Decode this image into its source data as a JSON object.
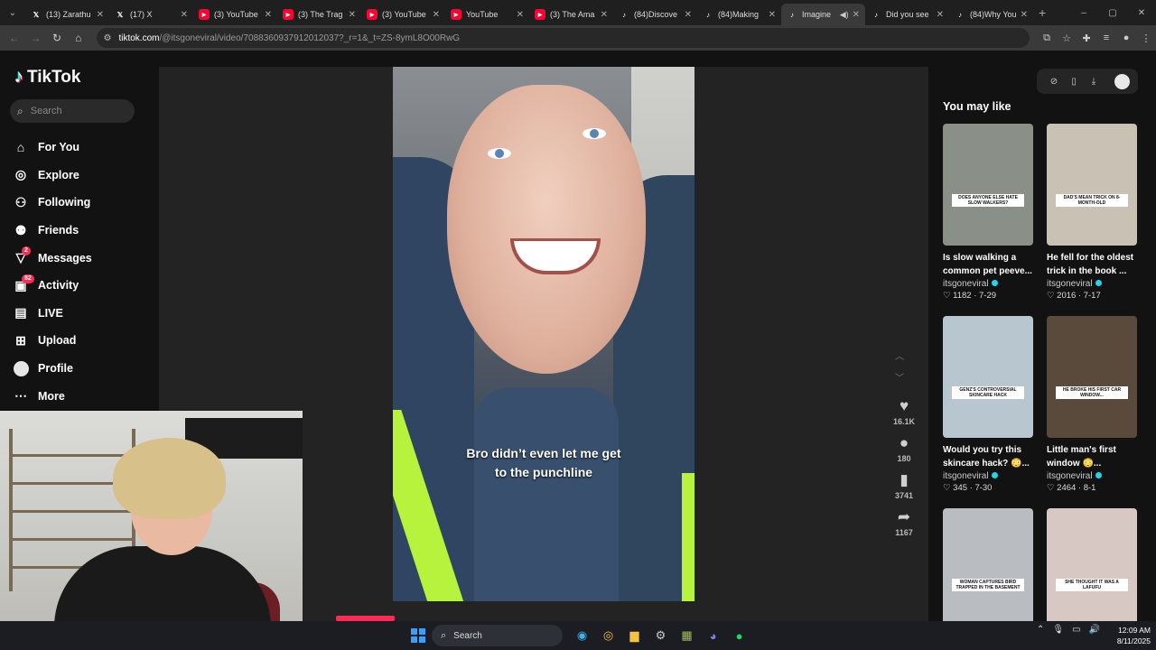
{
  "browser": {
    "tabs": [
      {
        "icon": "x",
        "title": "(13) Zarathu"
      },
      {
        "icon": "x",
        "title": "(17) X"
      },
      {
        "icon": "yt",
        "title": "(3) YouTube"
      },
      {
        "icon": "yt",
        "title": "(3) The Trag"
      },
      {
        "icon": "yt",
        "title": "(3) YouTube"
      },
      {
        "icon": "yt",
        "title": "YouTube"
      },
      {
        "icon": "yt",
        "title": "(3) The Ama"
      },
      {
        "icon": "tt",
        "title": "(84)Discove"
      },
      {
        "icon": "tt",
        "title": "(84)Making"
      },
      {
        "icon": "tt",
        "title": "Imagine"
      },
      {
        "icon": "tt",
        "title": "Did you see"
      },
      {
        "icon": "tt",
        "title": "(84)Why You"
      }
    ],
    "url_host": "tiktok.com",
    "url_path": "/@itsgoneviral/video/7088360937912012037?_r=1&_t=ZS-8ymL8O00RwG"
  },
  "tiktok": {
    "logo": "TikTok",
    "search_placeholder": "Search",
    "nav": [
      {
        "label": "For You",
        "icon": "home-icon"
      },
      {
        "label": "Explore",
        "icon": "compass-icon"
      },
      {
        "label": "Following",
        "icon": "following-icon"
      },
      {
        "label": "Friends",
        "icon": "friends-icon"
      },
      {
        "label": "Messages",
        "icon": "messages-icon",
        "badge": "2"
      },
      {
        "label": "Activity",
        "icon": "activity-icon",
        "badge": "82"
      },
      {
        "label": "LIVE",
        "icon": "live-icon"
      },
      {
        "label": "Upload",
        "icon": "upload-icon"
      },
      {
        "label": "Profile",
        "icon": "avatar"
      },
      {
        "label": "More",
        "icon": "more-icon"
      }
    ],
    "video": {
      "caption_line1": "Bro didn’t even let me get",
      "caption_line2": "to the punchline",
      "likes": "16.1K",
      "comments": "180",
      "saves": "3741",
      "shares": "1167",
      "progress": 0.11
    },
    "you_may_like": "You may like",
    "recommendations": [
      {
        "title": "Is slow walking a common pet peeve...",
        "author": "itsgoneviral",
        "stats": "1182 · 7-29",
        "thumb_text": "DOES ANYONE ELSE HATE SLOW WALKERS?",
        "bg": "#8a8f88"
      },
      {
        "title": "He fell for the oldest trick in the book ...",
        "author": "itsgoneviral",
        "stats": "2016 · 7-17",
        "thumb_text": "DAD'S MEAN TRICK ON 8-MONTH-OLD",
        "bg": "#c9c2b4"
      },
      {
        "title": "Would you try this skincare hack? 😳...",
        "author": "itsgoneviral",
        "stats": "345 · 7-30",
        "thumb_text": "GENZ'S CONTROVERSIAL SKINCARE HACK",
        "bg": "#b8c7cf"
      },
      {
        "title": "Little man's first window 😳...",
        "author": "itsgoneviral",
        "stats": "2464 · 8-1",
        "thumb_text": "HE BROKE HIS FIRST CAR WINDOW...",
        "bg": "#5a4a3c"
      },
      {
        "title": "",
        "author": "",
        "stats": "",
        "thumb_text": "WOMAN CAPTURES BIRD TRAPPED IN THE BASEMENT",
        "bg": "#b9bcc0"
      },
      {
        "title": "",
        "author": "",
        "stats": "",
        "thumb_text": "SHE THOUGHT IT WAS A LAFUFU",
        "bg": "#d8c8c4"
      }
    ]
  },
  "taskbar": {
    "search": "Search",
    "time": "12:09 AM",
    "date": "8/11/2025"
  },
  "colors": {
    "accent": "#fe2c55",
    "verified": "#20d5ec"
  }
}
